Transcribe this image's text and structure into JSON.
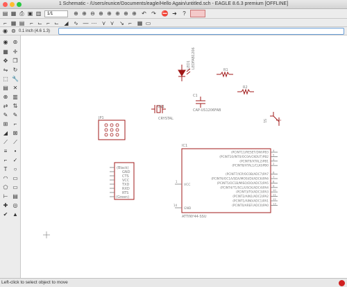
{
  "window": {
    "title": "1 Schematic - /Users/eunice/Documents/eagle/Hello Again/untitled.sch - EAGLE 8.6.3 premium [OFFLINE]"
  },
  "toolbar": {
    "sheet_value": "1/1"
  },
  "coord_display": "0.1 inch (4.6 1.3)",
  "command_line": {
    "value": ""
  },
  "status": {
    "text": "Left-click to select object to move"
  },
  "schematic": {
    "led": {
      "name": "LED1",
      "value": "LEDFAB1206"
    },
    "resistor1": {
      "name": "R1"
    },
    "resistor2": {
      "name": "R2"
    },
    "capacitor": {
      "name": "C1",
      "value": "CAP-US1206FAB"
    },
    "crystal": {
      "name": "U$1",
      "value": "CRYSTAL"
    },
    "switch": {
      "name": "S1"
    },
    "jp1": {
      "name": "JP1"
    },
    "ftdi": {
      "pins": [
        "(Black)",
        "GND",
        "CTS",
        "VCC",
        "TXD",
        "RXD",
        "RTS",
        "(Green)"
      ]
    },
    "ic1": {
      "name": "IC1",
      "value": "ATTINY44-SSU",
      "left_pins": [
        "VCC",
        "GND"
      ],
      "left_pin_numbers": [
        "1",
        "14"
      ],
      "right_pins": [
        "(PCINT11/RESET/DW)PB3",
        "(PCINT10/INT0/OC0A/CKOUT)PB2",
        "(PCINT9/XTAL2)PB1",
        "(PCINT8/XTAL1/CLKI)PB0",
        "(PCINT7/ICP/OC0B/ADC7)PA7",
        "(PCINT6/OC1A/SDA/MOSI/DI/ADC6)PA6",
        "(PCINT5/OC1B/MISO/DO/ADC5)PA5",
        "(PCINT4/T1/SCL/USCK/ADC4)PA4",
        "(PCINT3/T0/ADC3)PA3",
        "(PCINT2/AIN1/ADC2)PA2",
        "(PCINT1/AIN0/ADC1)PA1",
        "(PCINT0/AREF/ADC0)PA0"
      ],
      "right_pin_numbers": [
        "4",
        "5",
        "3",
        "2",
        "6",
        "7",
        "8",
        "9",
        "10",
        "11",
        "12",
        "13"
      ]
    }
  },
  "colors": {
    "wire": "#a01818",
    "canvas": "#ffffff",
    "pin": "#7a7a7a"
  }
}
